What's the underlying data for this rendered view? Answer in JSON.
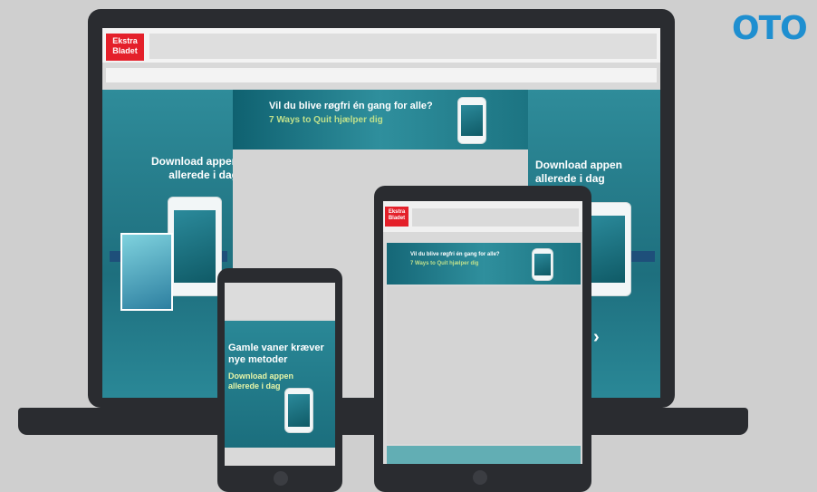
{
  "brand": {
    "logo_text": "OTO"
  },
  "site": {
    "logo_text": "Ekstra\nBladet"
  },
  "banner": {
    "headline": "Vil du blive røgfri én gang for alle?",
    "subline": "7 Ways to Quit hjælper dig"
  },
  "side_left": {
    "title": "Download appen\nallerede i dag"
  },
  "side_right": {
    "title": "Download appen\nallerede i dag"
  },
  "phone": {
    "headline": "Gamle vaner kræver\nnye metoder",
    "subline": "Download appen\nallerede i dag"
  },
  "colors": {
    "teal": "#2a8897",
    "frame": "#2a2c30",
    "logo_red": "#e4202a",
    "brand_blue": "#1f8fd0"
  }
}
